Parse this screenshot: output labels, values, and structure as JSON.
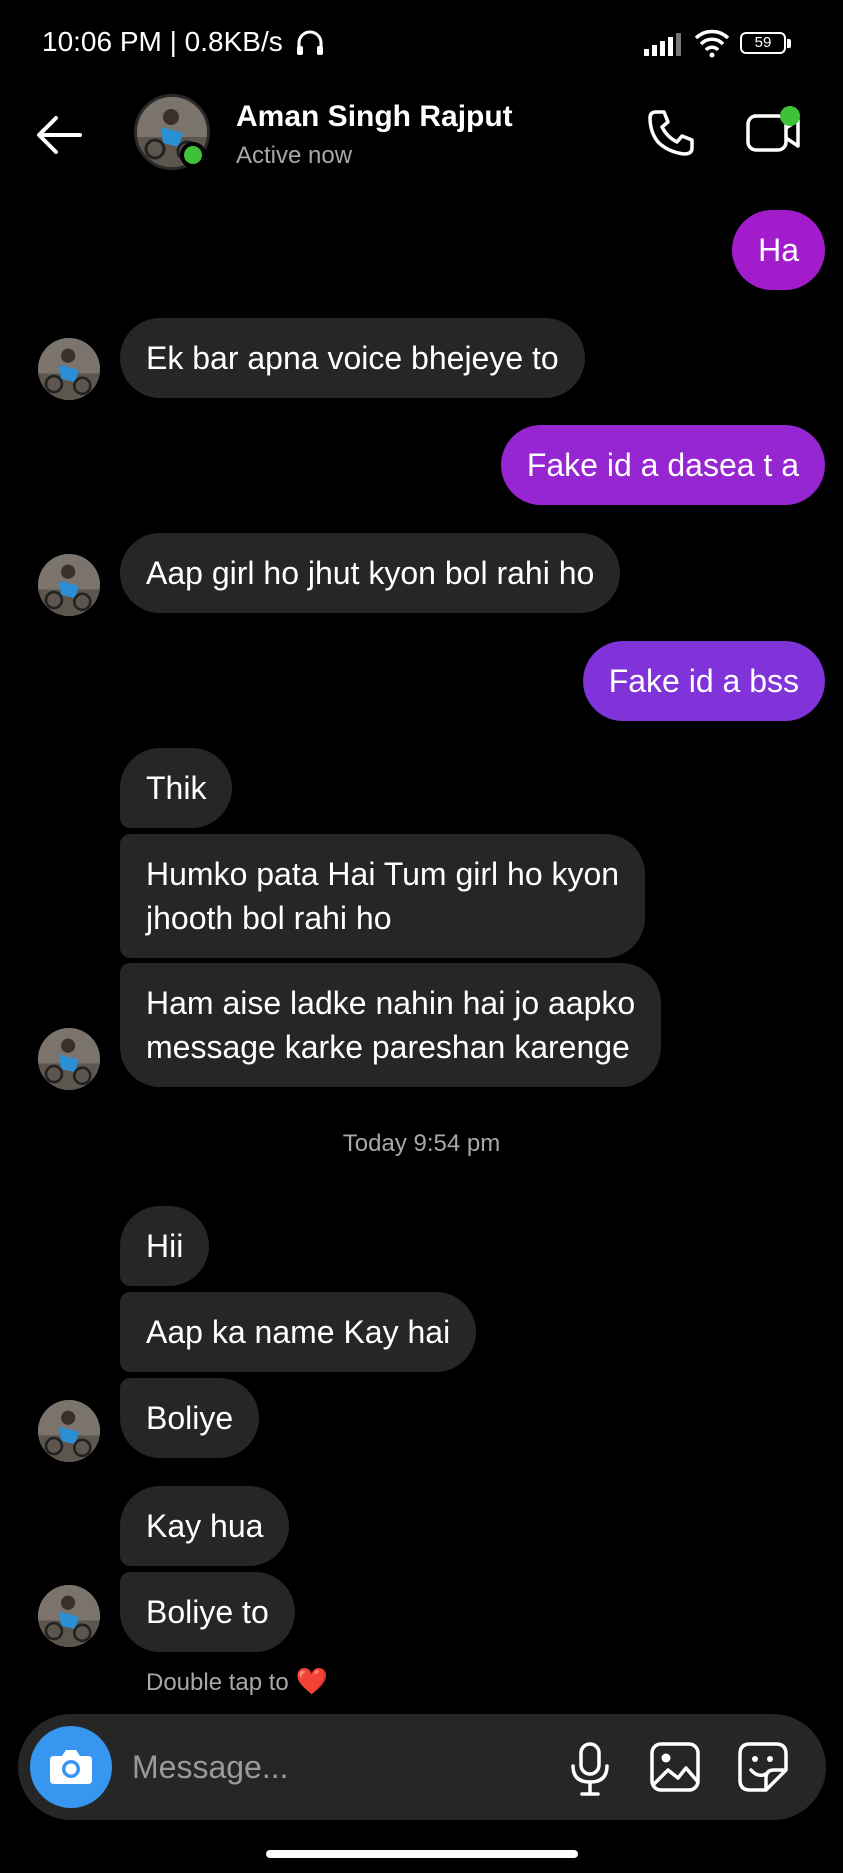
{
  "status_bar": {
    "time": "10:06 PM | 0.8KB/s",
    "battery": "59",
    "icons": [
      "headset-icon",
      "signal-icon",
      "wifi-icon",
      "battery-icon"
    ]
  },
  "header": {
    "contact_name": "Aman Singh Rajput",
    "contact_status": "Active now",
    "icons": [
      "back-arrow-icon",
      "phone-icon",
      "video-call-icon"
    ]
  },
  "messages": [
    {
      "from": "me",
      "text": "Ha"
    },
    {
      "from": "them",
      "text": "Ek bar apna voice bhejeye to"
    },
    {
      "from": "me",
      "text": "Fake id a dasea t a"
    },
    {
      "from": "them",
      "text": "Aap girl ho jhut kyon bol rahi ho"
    },
    {
      "from": "me",
      "text": "Fake id a bss"
    },
    {
      "from": "them",
      "text": "Thik"
    },
    {
      "from": "them",
      "text": "Humko pata Hai Tum girl ho kyon\njhooth bol rahi ho"
    },
    {
      "from": "them",
      "text": "Ham aise ladke nahin hai jo aapko\nmessage karke pareshan karenge"
    },
    {
      "from": "them",
      "text": "Hii"
    },
    {
      "from": "them",
      "text": "Aap ka name Kay hai"
    },
    {
      "from": "them",
      "text": "Boliye"
    },
    {
      "from": "them",
      "text": "Kay hua"
    },
    {
      "from": "them",
      "text": "Boliye to"
    }
  ],
  "timestamp": "Today 9:54 pm",
  "hint": "Double tap to",
  "hint_emoji": "❤️",
  "composer": {
    "placeholder": "Message...",
    "icons": [
      "camera-icon",
      "microphone-icon",
      "gallery-icon",
      "sticker-icon"
    ]
  },
  "colors": {
    "background": "#000000",
    "incoming_bubble": "#262626",
    "outgoing_bubble_top": "#a21ccb",
    "outgoing_bubble_bottom": "#7f33d9",
    "online": "#3fc23a",
    "camera_button": "#3797f0"
  }
}
